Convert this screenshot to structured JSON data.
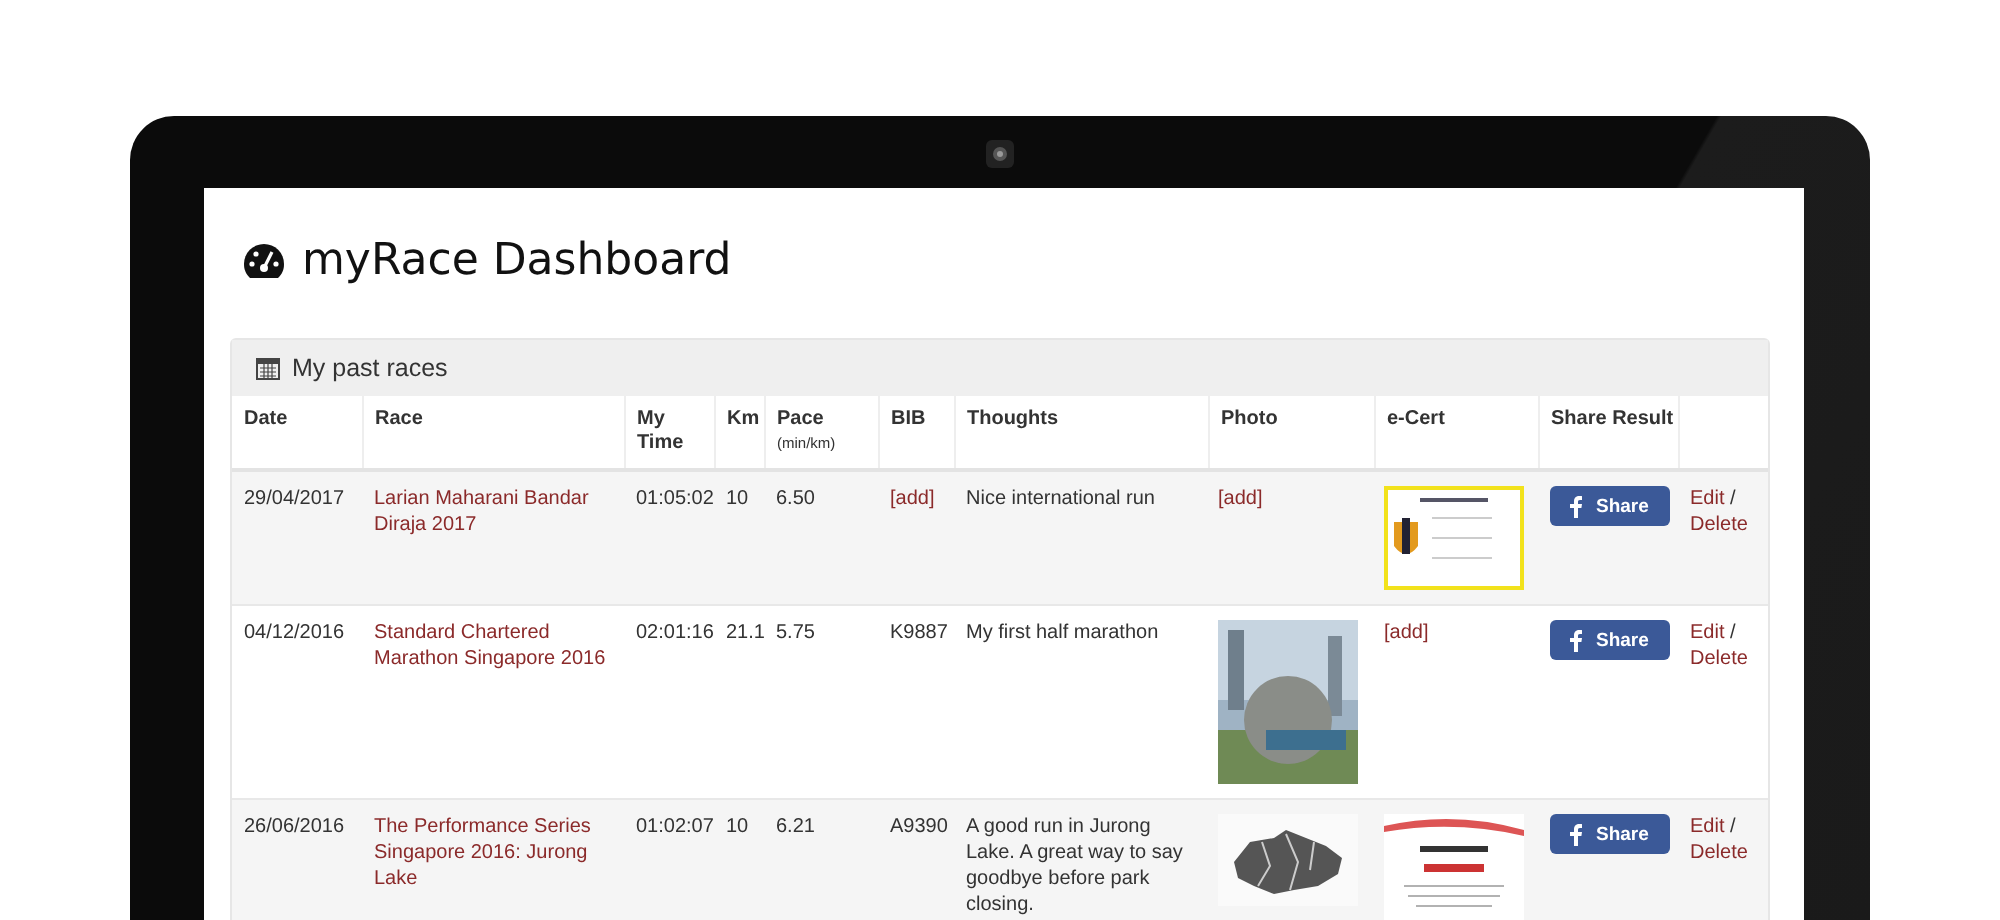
{
  "page": {
    "title": "myRace Dashboard"
  },
  "panel": {
    "title": "My past races"
  },
  "table": {
    "columns": [
      {
        "label": "Date"
      },
      {
        "label": "Race"
      },
      {
        "label": "My Time"
      },
      {
        "label": "Km"
      },
      {
        "label": "Pace",
        "sublabel": "(min/km)"
      },
      {
        "label": "BIB"
      },
      {
        "label": "Thoughts"
      },
      {
        "label": "Photo"
      },
      {
        "label": "e-Cert"
      },
      {
        "label": "Share Result"
      }
    ],
    "rows": [
      {
        "date": "29/04/2017",
        "race": "Larian Maharani Bandar Diraja 2017",
        "time": "01:05:02",
        "km": "10",
        "pace": "6.50",
        "bib": {
          "kind": "link",
          "text": "[add]"
        },
        "thoughts": "Nice international run",
        "photo": {
          "kind": "link",
          "text": "[add]"
        },
        "ecert": {
          "kind": "framed"
        },
        "share": "Share",
        "edit": "Edit",
        "separator": "/",
        "delete": "Delete"
      },
      {
        "date": "04/12/2016",
        "race": "Standard Chartered Marathon Singapore 2016",
        "time": "02:01:16",
        "km": "21.1",
        "pace": "5.75",
        "bib": {
          "kind": "text",
          "text": "K9887"
        },
        "thoughts": "My first half marathon",
        "photo": {
          "kind": "photo"
        },
        "ecert": {
          "kind": "link",
          "text": "[add]"
        },
        "share": "Share",
        "edit": "Edit",
        "separator": "/",
        "delete": "Delete"
      },
      {
        "date": "26/06/2016",
        "race": "The Performance Series Singapore 2016: Jurong Lake",
        "time": "01:02:07",
        "km": "10",
        "pace": "6.21",
        "bib": {
          "kind": "text",
          "text": "A9390"
        },
        "thoughts": "A good run in Jurong Lake. A great way to say goodbye before park closing.",
        "photo": {
          "kind": "map"
        },
        "ecert": {
          "kind": "plain"
        },
        "share": "Share",
        "edit": "Edit",
        "separator": "/",
        "delete": "Delete"
      }
    ]
  }
}
